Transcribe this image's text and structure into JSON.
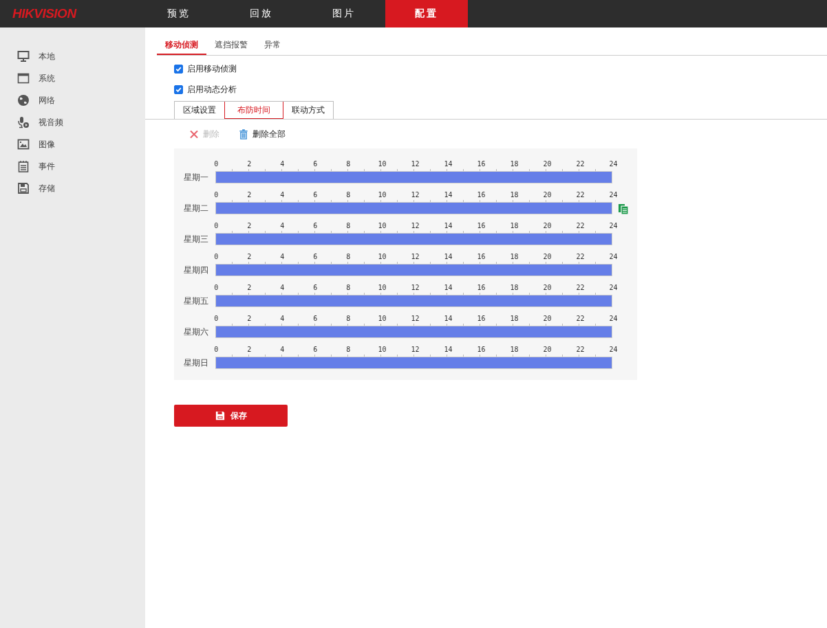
{
  "logo": "HIKVISION",
  "nav": [
    {
      "label": "预览",
      "selected": false
    },
    {
      "label": "回放",
      "selected": false
    },
    {
      "label": "图片",
      "selected": false
    },
    {
      "label": "配置",
      "selected": true
    }
  ],
  "sidebar": {
    "items": [
      {
        "label": "本地"
      },
      {
        "label": "系统"
      },
      {
        "label": "网络"
      },
      {
        "label": "视音频"
      },
      {
        "label": "图像"
      },
      {
        "label": "事件"
      },
      {
        "label": "存储"
      }
    ]
  },
  "tabs": [
    {
      "label": "移动侦测",
      "selected": true
    },
    {
      "label": "遮挡报警",
      "selected": false
    },
    {
      "label": "异常",
      "selected": false
    }
  ],
  "options": [
    {
      "label": "启用移动侦测",
      "checked": true
    },
    {
      "label": "启用动态分析",
      "checked": true
    }
  ],
  "steps": [
    {
      "label": "区域设置",
      "selected": false
    },
    {
      "label": "布防时间",
      "selected": true
    },
    {
      "label": "联动方式",
      "selected": false
    }
  ],
  "actions": [
    {
      "label": "删除",
      "kind": "delete",
      "disabled": true
    },
    {
      "label": "删除全部",
      "kind": "delete_all",
      "disabled": false
    }
  ],
  "schedule": [
    {
      "day": "星期一",
      "level": 1,
      "copy_icon": false,
      "scale": [
        "0",
        "2",
        "4",
        "6",
        "8",
        "10",
        "12",
        "14",
        "16",
        "18",
        "20",
        "22",
        "24"
      ]
    },
    {
      "day": "星期二",
      "level": 1,
      "copy_icon": true,
      "scale": [
        "0",
        "2",
        "4",
        "6",
        "8",
        "10",
        "12",
        "14",
        "16",
        "18",
        "20",
        "22",
        "24"
      ]
    },
    {
      "day": "星期三",
      "level": 1,
      "copy_icon": false,
      "scale": [
        "0",
        "2",
        "4",
        "6",
        "8",
        "10",
        "12",
        "14",
        "16",
        "18",
        "20",
        "22",
        "24"
      ]
    },
    {
      "day": "星期四",
      "level": 1,
      "copy_icon": false,
      "scale": [
        "0",
        "2",
        "4",
        "6",
        "8",
        "10",
        "12",
        "14",
        "16",
        "18",
        "20",
        "22",
        "24"
      ]
    },
    {
      "day": "星期五",
      "level": 1,
      "copy_icon": false,
      "scale": [
        "0",
        "2",
        "4",
        "6",
        "8",
        "10",
        "12",
        "14",
        "16",
        "18",
        "20",
        "22",
        "24"
      ]
    },
    {
      "day": "星期六",
      "level": 1,
      "copy_icon": false,
      "scale": [
        "0",
        "2",
        "4",
        "6",
        "8",
        "10",
        "12",
        "14",
        "16",
        "18",
        "20",
        "22",
        "24"
      ]
    },
    {
      "day": "星期日",
      "level": 1,
      "copy_icon": false,
      "scale": [
        "0",
        "2",
        "4",
        "6",
        "8",
        "10",
        "12",
        "14",
        "16",
        "18",
        "20",
        "22",
        "24"
      ]
    }
  ],
  "save_button": "保存"
}
